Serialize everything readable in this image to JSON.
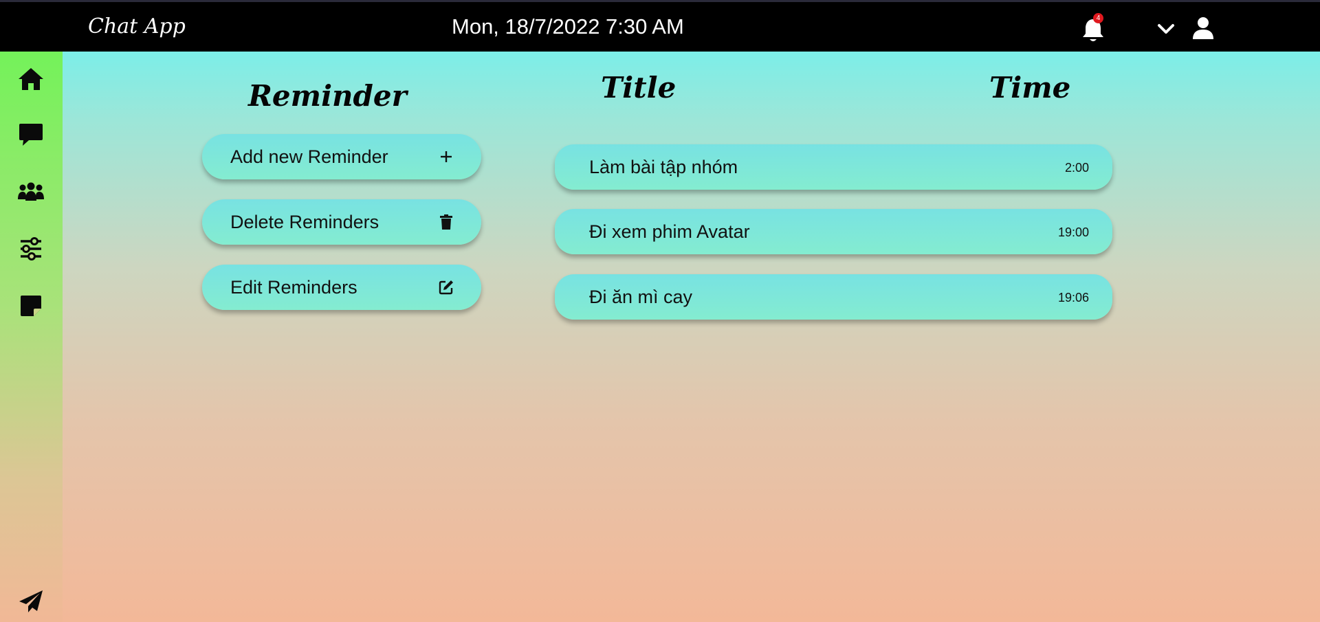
{
  "header": {
    "brand": "Chat App",
    "datetime": "Mon, 18/7/2022 7:30 AM",
    "notification_count": "4"
  },
  "sidebar": {
    "items": [
      {
        "icon": "home-icon"
      },
      {
        "icon": "chat-icon"
      },
      {
        "icon": "group-icon"
      },
      {
        "icon": "settings-sliders-icon"
      },
      {
        "icon": "sticky-note-icon"
      },
      {
        "icon": "send-icon"
      }
    ]
  },
  "main": {
    "reminder_heading": "Reminder",
    "title_heading": "Title",
    "time_heading": "Time",
    "actions": [
      {
        "label": "Add new Reminder",
        "icon": "plus-icon"
      },
      {
        "label": "Delete Reminders",
        "icon": "trash-icon"
      },
      {
        "label": "Edit Reminders",
        "icon": "edit-icon"
      }
    ],
    "reminders": [
      {
        "title": "Làm bài tập nhóm",
        "time": "2:00"
      },
      {
        "title": "Đi xem phim Avatar",
        "time": "19:00"
      },
      {
        "title": "Đi ăn mì cay",
        "time": "19:06"
      }
    ]
  },
  "colors": {
    "topbar": "#000000",
    "sidebar_top": "#74f25a",
    "button": "#78e2e2",
    "badge": "#e0191f"
  }
}
